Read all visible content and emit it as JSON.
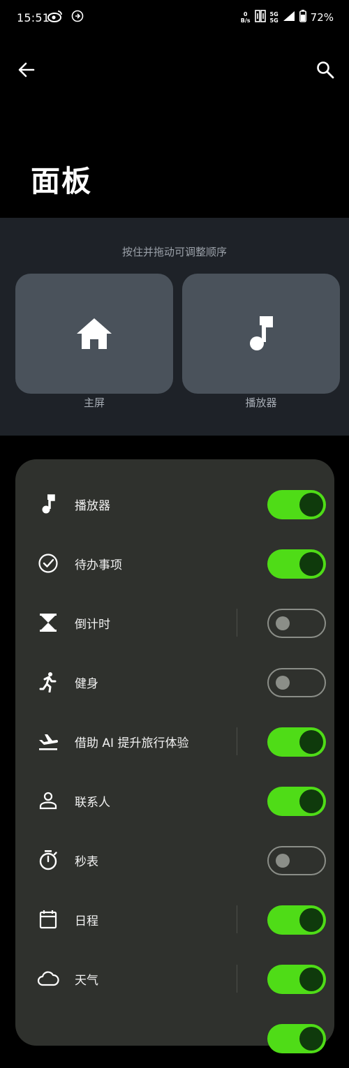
{
  "status_bar": {
    "time": "15:51",
    "net_speed_value": "0",
    "net_speed_unit": "B/s",
    "sim1_label": "5G",
    "sim2_label": "5G",
    "battery_percent": "72%",
    "icons": [
      "weibo-icon",
      "navigation-icon",
      "hd-icon",
      "signal-icon",
      "battery-icon"
    ]
  },
  "header": {
    "title": "面板",
    "back_icon": "arrow-left-icon",
    "search_icon": "search-icon"
  },
  "order_section": {
    "hint": "按住并拖动可调整顺序",
    "tiles": [
      {
        "label": "主屏",
        "icon": "home-icon"
      },
      {
        "label": "播放器",
        "icon": "music-note-icon"
      }
    ]
  },
  "panel_list": {
    "items": [
      {
        "label": "播放器",
        "icon": "music-note-icon",
        "enabled": true,
        "divider": false
      },
      {
        "label": "待办事项",
        "icon": "check-circle-icon",
        "enabled": true,
        "divider": false
      },
      {
        "label": "倒计时",
        "icon": "hourglass-icon",
        "enabled": false,
        "divider": true
      },
      {
        "label": "健身",
        "icon": "running-icon",
        "enabled": false,
        "divider": false
      },
      {
        "label": "借助 AI 提升旅行体验",
        "icon": "flight-icon",
        "enabled": true,
        "divider": true
      },
      {
        "label": "联系人",
        "icon": "person-icon",
        "enabled": true,
        "divider": false
      },
      {
        "label": "秒表",
        "icon": "stopwatch-icon",
        "enabled": false,
        "divider": false
      },
      {
        "label": "日程",
        "icon": "calendar-icon",
        "enabled": true,
        "divider": true
      },
      {
        "label": "天气",
        "icon": "cloud-icon",
        "enabled": true,
        "divider": true
      },
      {
        "label": "",
        "icon": "",
        "enabled": true,
        "divider": false
      }
    ]
  },
  "colors": {
    "toggle_on": "#4fdc17",
    "toggle_knob_on": "#0f3a0c",
    "toggle_off": "#8b8e88",
    "card_bg": "#2f312d",
    "section_bg": "#1e2228",
    "tile_bg": "#4a525b"
  }
}
